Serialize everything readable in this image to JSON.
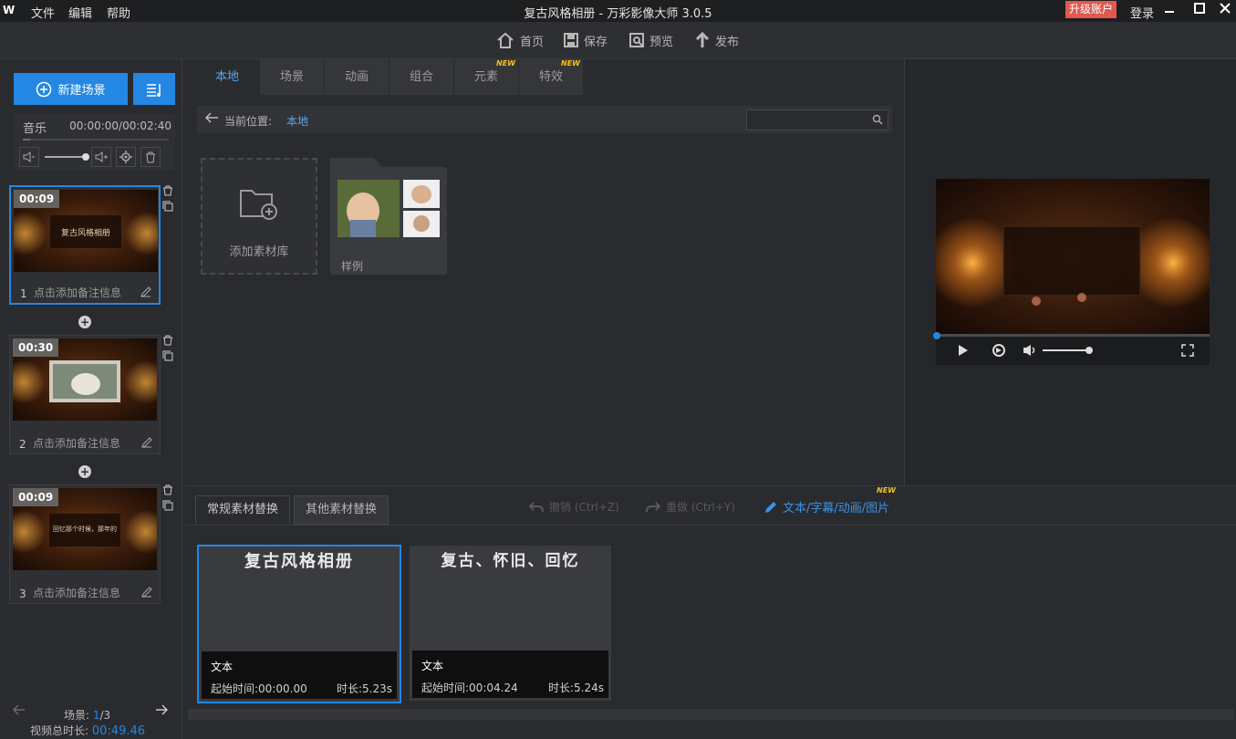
{
  "titlebar": {
    "logo": "W",
    "menu": [
      "文件",
      "编辑",
      "帮助"
    ],
    "title": "复古风格相册 - 万彩影像大师 3.0.5",
    "upgrade": "升级账户",
    "login": "登录"
  },
  "toolbar": {
    "home": "首页",
    "save": "保存",
    "preview": "预览",
    "publish": "发布"
  },
  "left": {
    "new_scene": "新建场景",
    "music": {
      "label": "音乐",
      "time": "00:00:00/00:02:40"
    },
    "scenes": [
      {
        "num": "1",
        "duration": "00:09",
        "note": "点击添加备注信息",
        "caption": "复古风格相册"
      },
      {
        "num": "2",
        "duration": "00:30",
        "note": "点击添加备注信息",
        "caption": ""
      },
      {
        "num": "3",
        "duration": "00:09",
        "note": "点击添加备注信息",
        "caption": "回忆那个时候，那年的"
      }
    ],
    "scene_count_label": "场景:",
    "scene_current": "1",
    "scene_total": "/3",
    "total_label": "视频总时长:",
    "total_value": "00:49.46"
  },
  "center": {
    "tabs": [
      {
        "label": "本地",
        "new": false
      },
      {
        "label": "场景",
        "new": false
      },
      {
        "label": "动画",
        "new": false
      },
      {
        "label": "组合",
        "new": false
      },
      {
        "label": "元素",
        "new": true
      },
      {
        "label": "特效",
        "new": true
      }
    ],
    "new_badge": "NEW",
    "crumb_label": "当前位置:",
    "crumb_value": "本地",
    "search_placeholder": "",
    "add_library": "添加素材库",
    "folder_label": "样例"
  },
  "bottom": {
    "tabs": [
      "常规素材替换",
      "其他素材替换"
    ],
    "undo": "撤销 (Ctrl+Z)",
    "redo": "重做 (Ctrl+Y)",
    "text_link": "文本/字幕/动画/图片",
    "cards": [
      {
        "title": "复古风格相册",
        "type": "文本",
        "start": "起始时间:00:00.00",
        "length": "时长:5.23s"
      },
      {
        "title": "复古、怀旧、回忆",
        "type": "文本",
        "start": "起始时间:00:04.24",
        "length": "时长:5.24s"
      }
    ]
  },
  "colors": {
    "accent": "#2487e3",
    "upgrade": "#e2584f",
    "new_badge": "#f3c21a"
  }
}
